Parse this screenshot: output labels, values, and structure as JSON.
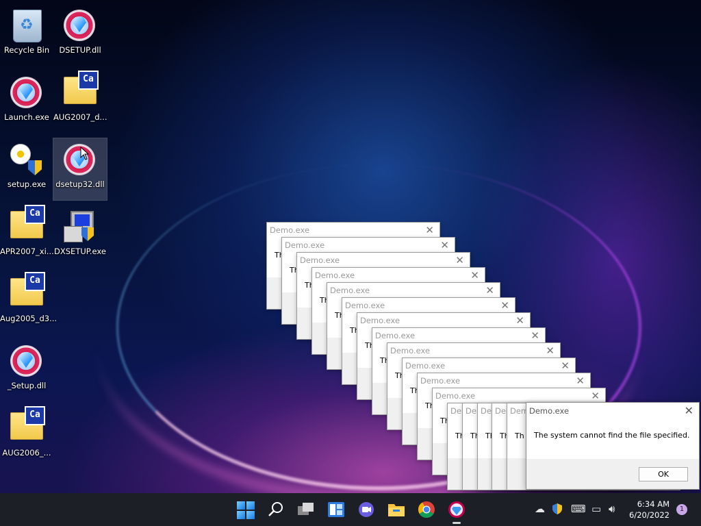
{
  "desktop": {
    "icons": [
      {
        "label": "Recycle Bin"
      },
      {
        "label": "DSETUP.dll"
      },
      {
        "label": "Launch.exe"
      },
      {
        "label": "AUG2007_d..."
      },
      {
        "label": "setup.exe"
      },
      {
        "label": "dsetup32.dll"
      },
      {
        "label": "APR2007_xi..."
      },
      {
        "label": "DXSETUP.exe"
      },
      {
        "label": "Aug2005_d3..."
      },
      {
        "label": "_Setup.dll"
      },
      {
        "label": "AUG2006_..."
      }
    ],
    "folder_badge": "Ca"
  },
  "dialogs": {
    "stacked_title": "Demo.exe",
    "stacked_title_short": "Dem",
    "stacked_body_short": "Th",
    "close_glyph": "✕",
    "main": {
      "title": "Demo.exe",
      "message": "The system cannot find the file specified.",
      "ok_label": "OK"
    }
  },
  "taskbar": {
    "icons": [
      "start-icon",
      "search-icon",
      "task-view-icon",
      "widgets-icon",
      "chat-icon",
      "file-explorer-icon",
      "chrome-icon",
      "demo-app-icon"
    ],
    "clock": {
      "time": "6:34 AM",
      "date": "6/20/2022"
    },
    "notification_count": "1",
    "tray_icons": [
      "network-icon",
      "security-icon",
      "keyboard-icon",
      "display-icon",
      "volume-icon"
    ]
  }
}
